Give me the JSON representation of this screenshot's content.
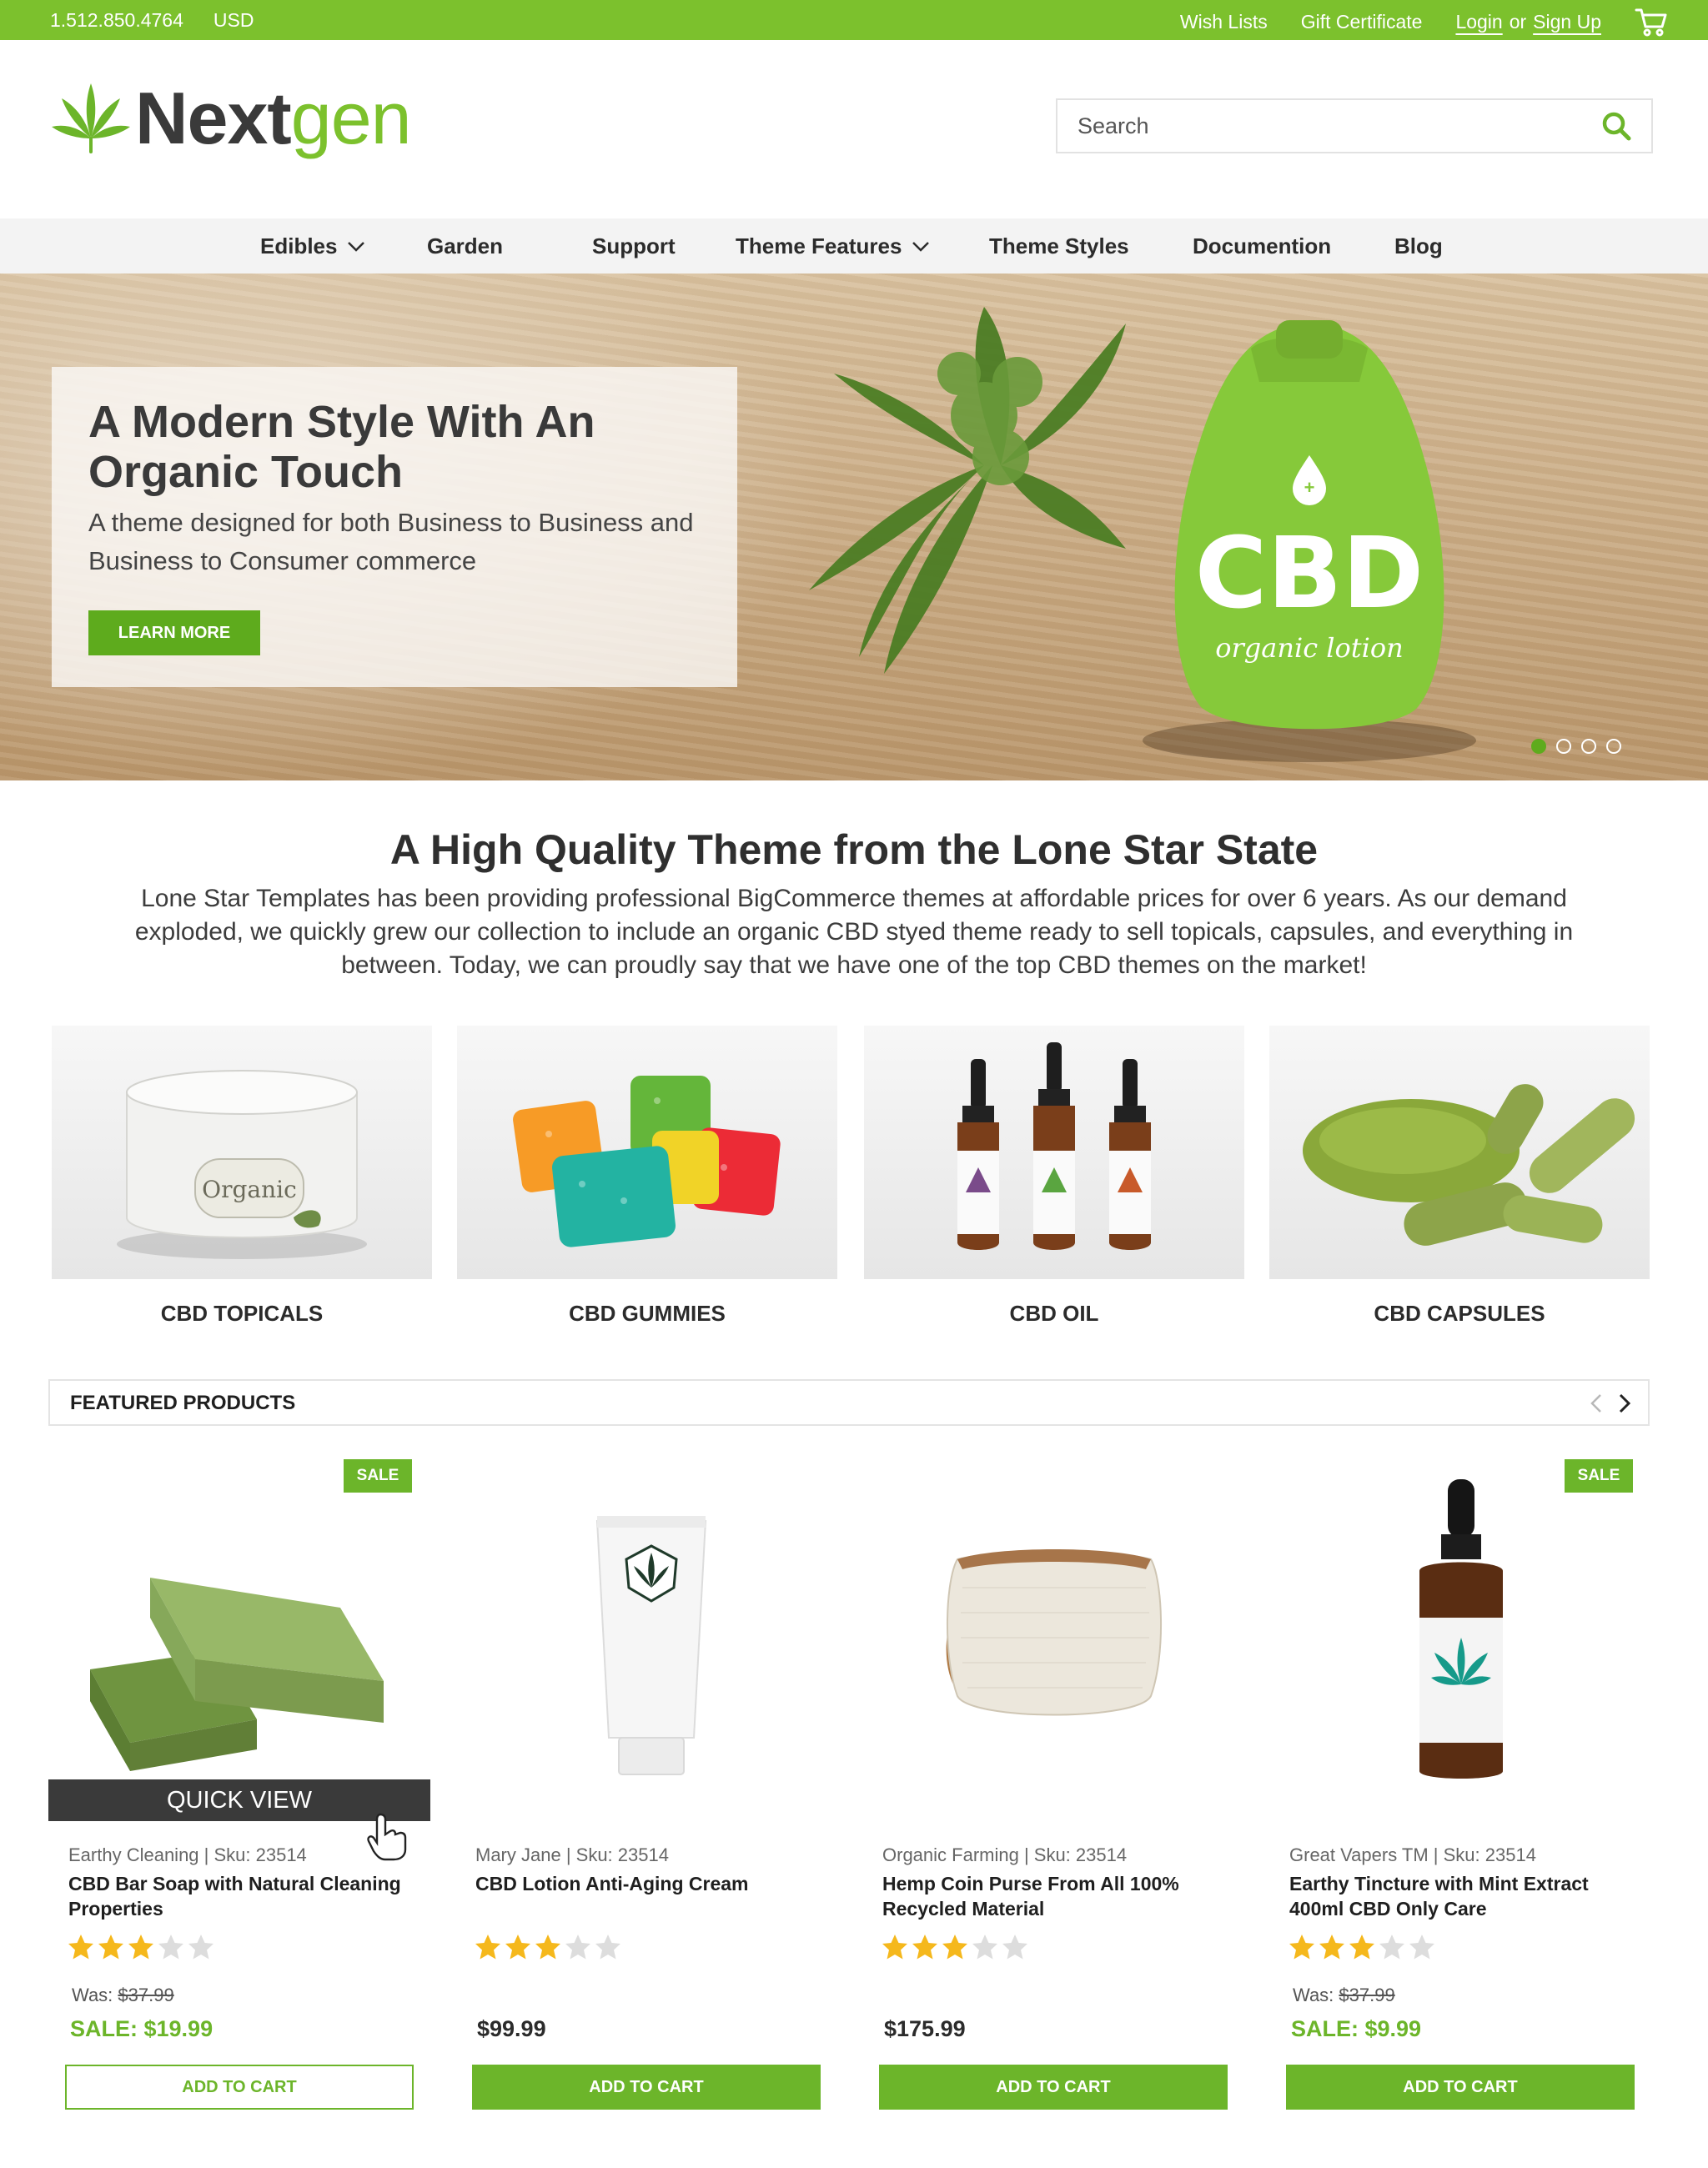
{
  "topbar": {
    "phone": "1.512.850.4764",
    "currency": "USD",
    "wish_lists": "Wish Lists",
    "gift_certificate": "Gift Certificate",
    "login": "Login",
    "or": "or",
    "sign_up": "Sign Up"
  },
  "logo": {
    "part1": "Next",
    "part2": "gen"
  },
  "search": {
    "placeholder": "Search"
  },
  "nav": {
    "edibles": "Edibles",
    "garden": "Garden",
    "support": "Support",
    "theme_features": "Theme Features",
    "theme_styles": "Theme Styles",
    "documention": "Documention",
    "blog": "Blog"
  },
  "hero": {
    "title": "A Modern Style With An Organic Touch",
    "subtitle": "A theme designed for both Business to Business and Business to Consumer commerce",
    "button": "LEARN MORE",
    "bottle_text": "CBD",
    "bottle_sub": "organic lotion",
    "slides": 4,
    "active_slide": 1
  },
  "intro": {
    "title": "A High Quality Theme from the Lone Star State",
    "text": "Lone Star Templates has been providing professional BigCommerce themes at affordable prices for over 6 years. As our demand exploded, we quickly grew our collection to include an organic CBD styed theme ready to sell topicals, capsules, and everything in between. Today, we can proudly say that we have one of the top CBD themes on the market!"
  },
  "categories": [
    {
      "label": "CBD TOPICALS"
    },
    {
      "label": "CBD GUMMIES"
    },
    {
      "label": "CBD OIL"
    },
    {
      "label": "CBD CAPSULES"
    }
  ],
  "featured": {
    "title": "FEATURED PRODUCTS"
  },
  "products": [
    {
      "brand_sku": "Earthy Cleaning  |  Sku: 23514",
      "name": "CBD Bar Soap  with Natural Cleaning Properties",
      "rating": 3,
      "was_label": "Was:",
      "was_price": "$37.99",
      "price": "SALE: $19.99",
      "sale_badge": "SALE",
      "quick_view": "QUICK VIEW",
      "button": "ADD TO CART"
    },
    {
      "brand_sku": "Mary Jane  |  Sku: 23514",
      "name": "CBD Lotion Anti-Aging Cream",
      "rating": 3,
      "price": "$99.99",
      "button": "ADD TO CART"
    },
    {
      "brand_sku": "Organic Farming  | Sku: 23514",
      "name": "Hemp Coin Purse From All 100% Recycled Material",
      "rating": 3,
      "price": "$175.99",
      "button": "ADD TO CART"
    },
    {
      "brand_sku": "Great Vapers TM  | Sku: 23514",
      "name": "Earthy Tincture with Mint Extract 400ml CBD Only Care",
      "rating": 3,
      "was_label": "Was:",
      "was_price": "$37.99",
      "price": "SALE: $9.99",
      "sale_badge": "SALE",
      "button": "ADD TO CART"
    }
  ],
  "colors": {
    "brand_green": "#7cc12d",
    "button_green": "#6cb52a",
    "star": "#f5b81c",
    "star_empty": "#dddddd"
  }
}
